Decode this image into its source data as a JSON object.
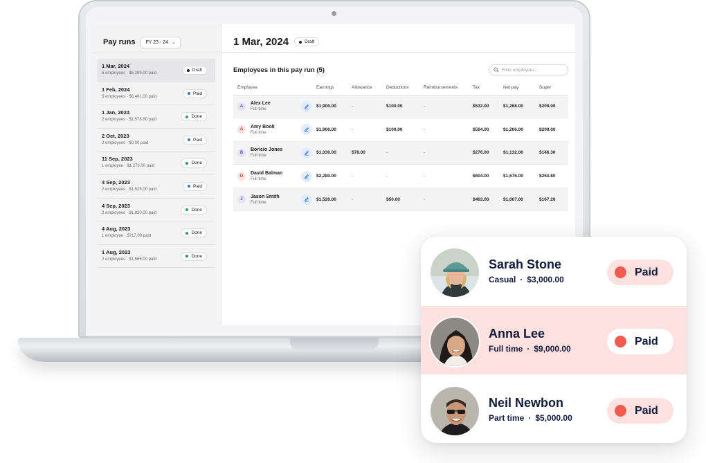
{
  "sidebar": {
    "title": "Pay runs",
    "fy_select": "FY 23 - 24",
    "payruns": [
      {
        "date": "1 Mar, 2024",
        "sub": "5 employees · $6,289.00 paid",
        "status": "Draft",
        "status_color": "#222222"
      },
      {
        "date": "1 Feb, 2024",
        "sub": "5 employees · $6,461.00 paid",
        "status": "Paid",
        "status_color": "#2f6fd6"
      },
      {
        "date": "1 Jan, 2024",
        "sub": "2 employees · $1,578.80 paid",
        "status": "Done",
        "status_color": "#2e9b4f"
      },
      {
        "date": "2 Oct, 2023",
        "sub": "2 employees · $0.00 paid",
        "status": "Paid",
        "status_color": "#2f6fd6"
      },
      {
        "date": "11 Sep, 2023",
        "sub": "1 employee · $1,273.00 paid",
        "status": "Done",
        "status_color": "#2e9b4f"
      },
      {
        "date": "4 Sep, 2023",
        "sub": "2 employees · $1,525.00 paid",
        "status": "Paid",
        "status_color": "#2f6fd6"
      },
      {
        "date": "4 Sep, 2023",
        "sub": "2 employees · $1,820.00 paid",
        "status": "Done",
        "status_color": "#2e9b4f"
      },
      {
        "date": "4 Aug, 2023",
        "sub": "1 employee · $717.00 paid",
        "status": "Done",
        "status_color": "#2e9b4f"
      },
      {
        "date": "1 Aug, 2023",
        "sub": "2 employees · $1,565.00 paid",
        "status": "Done",
        "status_color": "#2e9b4f"
      }
    ]
  },
  "main": {
    "title": "1 Mar, 2024",
    "status": "Draft",
    "section_title": "Employees in this pay run (5)",
    "filter_placeholder": "Filter employees...",
    "columns": [
      "Employee",
      "Earnings",
      "Allowance",
      "Deductions",
      "Reimbursements",
      "Tax",
      "Net pay",
      "Super"
    ],
    "rows": [
      {
        "initial": "A",
        "avatar_bg": "#e4e2f6",
        "avatar_fg": "#5a4fb0",
        "name": "Alex Lee",
        "type": "Full time",
        "earnings": "$1,900.00",
        "allowance": "-",
        "deductions": "$100.00",
        "reimbursements": "-",
        "tax": "$532.00",
        "net_pay": "$1,268.00",
        "super": "$209.00"
      },
      {
        "initial": "A",
        "avatar_bg": "#fbe0dd",
        "avatar_fg": "#c8463a",
        "name": "Amy Book",
        "type": "Full time",
        "earnings": "$1,900.00",
        "allowance": "-",
        "deductions": "$100.00",
        "reimbursements": "-",
        "tax": "$594.00",
        "net_pay": "$1,206.00",
        "super": "$209.00"
      },
      {
        "initial": "B",
        "avatar_bg": "#e4e2f6",
        "avatar_fg": "#5a4fb0",
        "name": "Boricio Jones",
        "type": "Full time",
        "earnings": "$1,330.00",
        "allowance": "$78.00",
        "deductions": "-",
        "reimbursements": "-",
        "tax": "$276.00",
        "net_pay": "$1,132.00",
        "super": "$146.30"
      },
      {
        "initial": "D",
        "avatar_bg": "#fbe0dd",
        "avatar_fg": "#c8463a",
        "name": "David Balman",
        "type": "Full time",
        "earnings": "$2,280.00",
        "allowance": "-",
        "deductions": "-",
        "reimbursements": "-",
        "tax": "$604.00",
        "net_pay": "$1,676.00",
        "super": "$250.80"
      },
      {
        "initial": "J",
        "avatar_bg": "#e4e2f6",
        "avatar_fg": "#5a4fb0",
        "name": "Jason Smith",
        "type": "Full time",
        "earnings": "$1,520.00",
        "allowance": "-",
        "deductions": "$50.00",
        "reimbursements": "-",
        "tax": "$463.00",
        "net_pay": "$1,007.00",
        "super": "$167.20"
      }
    ]
  },
  "card": {
    "people": [
      {
        "name": "Sarah Stone",
        "type": "Casual",
        "amount": "$3,000.00",
        "status": "Paid"
      },
      {
        "name": "Anna Lee",
        "type": "Full time",
        "amount": "$9,000.00",
        "status": "Paid"
      },
      {
        "name": "Neil Newbon",
        "type": "Part time",
        "amount": "$5,000.00",
        "status": "Paid"
      }
    ]
  },
  "icons": {
    "dropdown": "chevron-down-icon",
    "search": "search-icon",
    "edit": "pencil-icon",
    "status_dot": "dot-icon"
  },
  "colors": {
    "accent_red": "#f45b4f",
    "highlight_row": "#fde1df",
    "navy_text": "#121a3a"
  }
}
